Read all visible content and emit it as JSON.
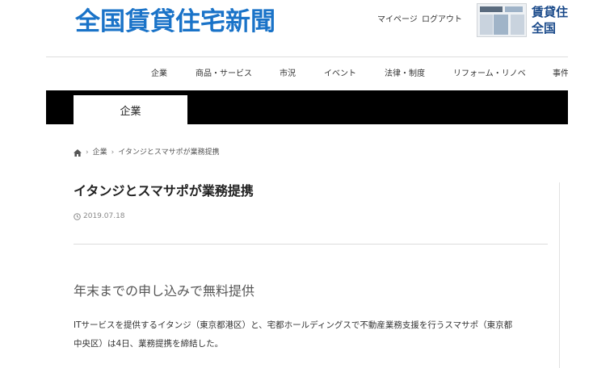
{
  "header": {
    "logo_text": "全国賃貸住宅新聞",
    "mypage_label": "マイページ",
    "logout_label": "ログアウト",
    "promo_text_line1": "賃貸住",
    "promo_text_line2": "全国"
  },
  "nav": {
    "items": [
      {
        "label": "企業"
      },
      {
        "label": "商品・サービス"
      },
      {
        "label": "市況"
      },
      {
        "label": "イベント"
      },
      {
        "label": "法律・制度"
      },
      {
        "label": "リフォーム・リノベ"
      },
      {
        "label": "事件"
      }
    ]
  },
  "category_banner": {
    "active_tab": "企業"
  },
  "breadcrumb": {
    "home_icon": "home-icon",
    "items": [
      "企業",
      "イタンジとスマサポが業務提携"
    ]
  },
  "article": {
    "title": "イタンジとスマサポが業務提携",
    "date": "2019.07.18",
    "subheading": "年末までの申し込みで無料提供",
    "body_line1": "ITサービスを提供するイタンジ（東京都港区）と、宅都ホールディングスで不動産業務支援を行うスマサポ（東京都",
    "body_line2": "中央区）は4日、業務提携を締結した。"
  },
  "colors": {
    "logo_blue": "#1a73c8",
    "band_black": "#000000",
    "text_dark": "#222222"
  }
}
